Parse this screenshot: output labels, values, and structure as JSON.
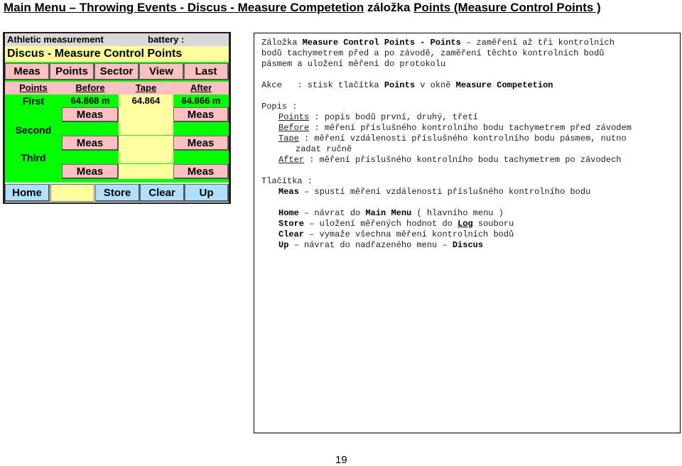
{
  "header": {
    "title_part1": "Main Menu – Throwing Events - Discus - Measure Competetion",
    "title_part2": "záložka",
    "title_part3": "Points (Measure Control Points )"
  },
  "device": {
    "app_title": "Athletic measurement",
    "battery_label": "battery :",
    "screen_title": "Discus - Measure Control Points",
    "tabs": [
      "Meas",
      "Points",
      "Sector",
      "View",
      "Last"
    ],
    "subtabs": [
      "Points",
      "Before",
      "Tape",
      "After"
    ],
    "rows": {
      "first": {
        "label": "First",
        "before": "64.868 m",
        "tape": "64.864",
        "after": "64.866 m"
      },
      "second": {
        "label": "Second"
      },
      "third": {
        "label": "Third"
      }
    },
    "meas_label": "Meas",
    "bottom_buttons": {
      "home": "Home",
      "store": "Store",
      "clear": "Clear",
      "up": "Up"
    }
  },
  "panel": {
    "intro": {
      "l1a": "Záložka ",
      "l1b": "Measure Control Points - Points",
      "l1c": " – zaměření až tři kontrolních",
      "l2": "bodů tachymetrem před a po závodě, zaměření těchto kontrolních bodů",
      "l3": "pásmem a uložení měření do protokolu"
    },
    "akce": {
      "a": "Akce   : stisk tlačítka ",
      "b": "Points",
      "c": " v okně ",
      "d": "Measure Competetion"
    },
    "popis": {
      "title": "Popis :",
      "points_term": "Points",
      "points_desc": " : popis bodů první, druhý, třetí",
      "before_term": "Before",
      "before_desc": " : měření příslušného kontrolního bodu tachymetrem před závodem",
      "tape_term": "Tape",
      "tape_desc": " : měření vzdálenosti příslušného kontrolního bodu pásmem, nutno",
      "tape_desc2": "zadat ručně",
      "after_term": "After",
      "after_desc": " : měření příslušného kontrolního bodu tachymetrem po závodech"
    },
    "tlacitka": {
      "title": "Tlačítka :",
      "meas_term": "Meas",
      "meas_desc": " – spustí měření vzdálenosti příslušného kontrolního bodu",
      "home_term": "Home",
      "home_desc_a": " – návrat do ",
      "home_desc_b": "Main Menu",
      "home_desc_c": " ( hlavního menu )",
      "store_term": "Store",
      "store_desc_a": " – uložení měřených hodnot do ",
      "store_desc_b": "Log",
      "store_desc_c": " souboru",
      "clear_term": "Clear",
      "clear_desc": " – vymaže všechna měření kontrolních bodů",
      "up_term": "Up",
      "up_desc_a": " – návrat do nadřazeného menu – ",
      "up_desc_b": "Discus"
    }
  },
  "page_number": "19"
}
